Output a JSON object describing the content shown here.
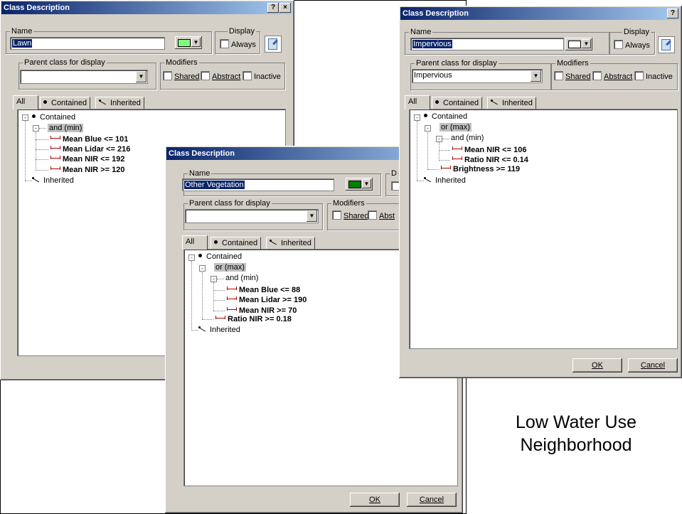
{
  "dialog_lawn": {
    "title": "Class Description",
    "help": "?",
    "close": "×",
    "name_label": "Name",
    "name_value": "Lawn",
    "display_label": "Display",
    "always_label": "Always",
    "parent_label": "Parent class for display",
    "parent_value": "",
    "modifiers_label": "Modifiers",
    "shared": "Shared",
    "abstract": "Abstract",
    "inactive": "Inactive",
    "swatch_color": "#7fff7f",
    "tabs": [
      "All",
      "Contained",
      "Inherited"
    ],
    "tree": {
      "contained": "Contained",
      "op": "and (min)",
      "items": [
        "Mean Blue <= 101",
        "Mean Lidar <= 216",
        "Mean NIR <= 192",
        "Mean NIR >= 120"
      ],
      "inherited": "Inherited"
    }
  },
  "dialog_veg": {
    "title": "Class Description",
    "name_label": "Name",
    "name_value": "Other Vegetation",
    "display_label_partial": "D",
    "parent_label": "Parent class for display",
    "parent_value": "",
    "modifiers_label": "Modifiers",
    "shared": "Shared",
    "abstract_partial": "Abst",
    "swatch_color": "#008000",
    "tabs": [
      "All",
      "Contained",
      "Inherited"
    ],
    "tree": {
      "contained": "Contained",
      "op_or": "or (max)",
      "op_and": "and (min)",
      "items": [
        "Mean Blue <= 88",
        "Mean Lidar >= 190",
        "Mean NIR >= 70"
      ],
      "outer_item": "Ratio NIR >= 0.18",
      "inherited": "Inherited"
    },
    "ok": "OK",
    "cancel": "Cancel"
  },
  "dialog_imp": {
    "title": "Class Description",
    "help": "?",
    "name_label": "Name",
    "name_value": "Impervious",
    "display_label": "Display",
    "always_label": "Always",
    "parent_label": "Parent class for display",
    "parent_value": "Impervious",
    "modifiers_label": "Modifiers",
    "shared": "Shared",
    "abstract": "Abstract",
    "inactive": "Inactive",
    "swatch_color": "#ffffff",
    "tabs": [
      "All",
      "Contained",
      "Inherited"
    ],
    "tree": {
      "contained": "Contained",
      "op_or": "or (max)",
      "op_and": "and (min)",
      "items": [
        "Mean NIR <= 106",
        "Ratio NIR <= 0.14"
      ],
      "outer_item": "Brightness >= 119",
      "inherited": "Inherited"
    },
    "ok": "OK",
    "cancel": "Cancel"
  },
  "caption": {
    "line1": "Low Water Use",
    "line2": "Neighborhood"
  }
}
